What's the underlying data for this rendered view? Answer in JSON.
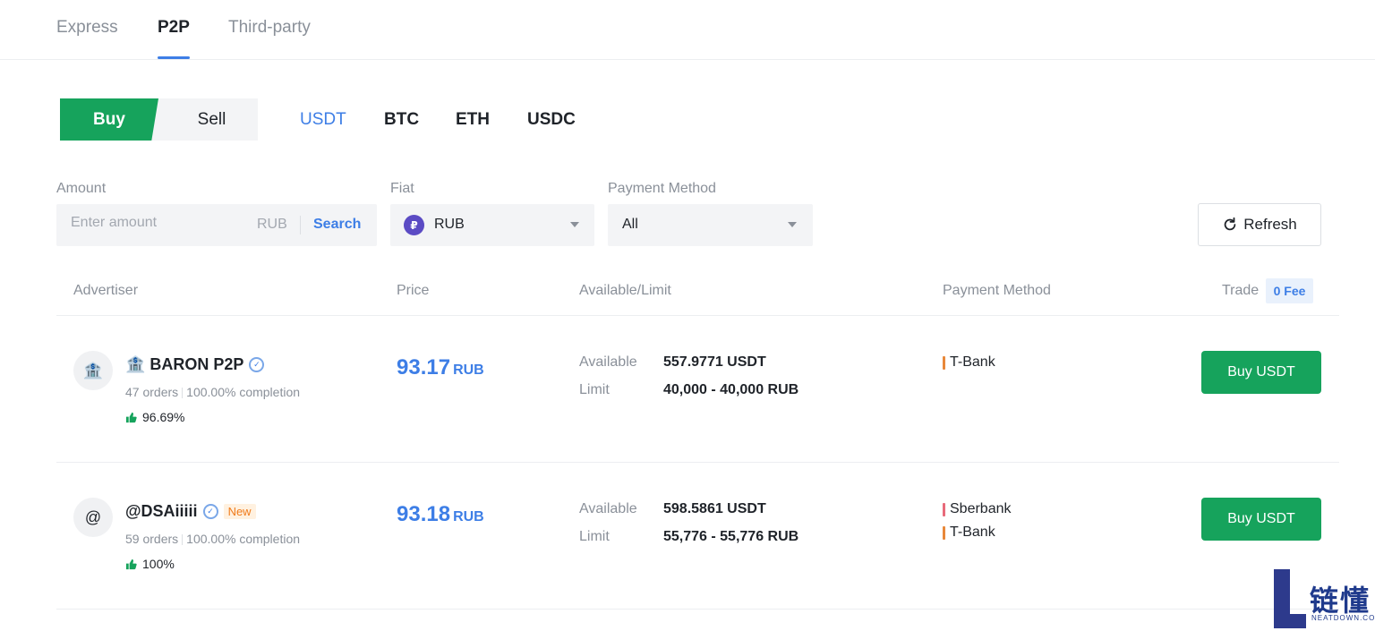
{
  "top_tabs": [
    {
      "label": "Express"
    },
    {
      "label": "P2P"
    },
    {
      "label": "Third-party"
    }
  ],
  "side_toggle": {
    "buy": "Buy",
    "sell": "Sell"
  },
  "coins": [
    "USDT",
    "BTC",
    "ETH",
    "USDC"
  ],
  "filters": {
    "amount": {
      "label": "Amount",
      "placeholder": "Enter amount",
      "unit": "RUB",
      "search": "Search"
    },
    "fiat": {
      "label": "Fiat",
      "icon_glyph": "₽",
      "value": "RUB"
    },
    "payment": {
      "label": "Payment Method",
      "value": "All"
    },
    "refresh": "Refresh"
  },
  "table": {
    "headers": {
      "advertiser": "Advertiser",
      "price": "Price",
      "available_limit": "Available/Limit",
      "payment": "Payment Method",
      "trade": "Trade",
      "fee_badge": "0 Fee"
    },
    "available_label": "Available",
    "limit_label": "Limit",
    "rows": [
      {
        "avatar": "🏦",
        "name": "🏦 BARON P2P",
        "orders": "47 orders",
        "completion": "100.00% completion",
        "rating": "96.69%",
        "price": "93.17",
        "price_currency": "RUB",
        "available": "557.9771 USDT",
        "limit": "40,000 - 40,000 RUB",
        "payments": [
          {
            "name": "T-Bank",
            "color": "#e8883a"
          }
        ],
        "button": "Buy USDT"
      },
      {
        "avatar": "@",
        "name": "@DSAiiiii",
        "new_badge": "New",
        "orders": "59 orders",
        "completion": "100.00% completion",
        "rating": "100%",
        "price": "93.18",
        "price_currency": "RUB",
        "available": "598.5861 USDT",
        "limit": "55,776 - 55,776 RUB",
        "payments": [
          {
            "name": "Sberbank",
            "color": "#e86a7a"
          },
          {
            "name": "T-Bank",
            "color": "#e8883a"
          }
        ],
        "button": "Buy USDT"
      }
    ]
  },
  "colors": {
    "accent": "#3d7ee6",
    "buy_green": "#16a35c"
  },
  "watermark": {
    "text": "链懂",
    "sub": "NEATDOWN.COM"
  }
}
